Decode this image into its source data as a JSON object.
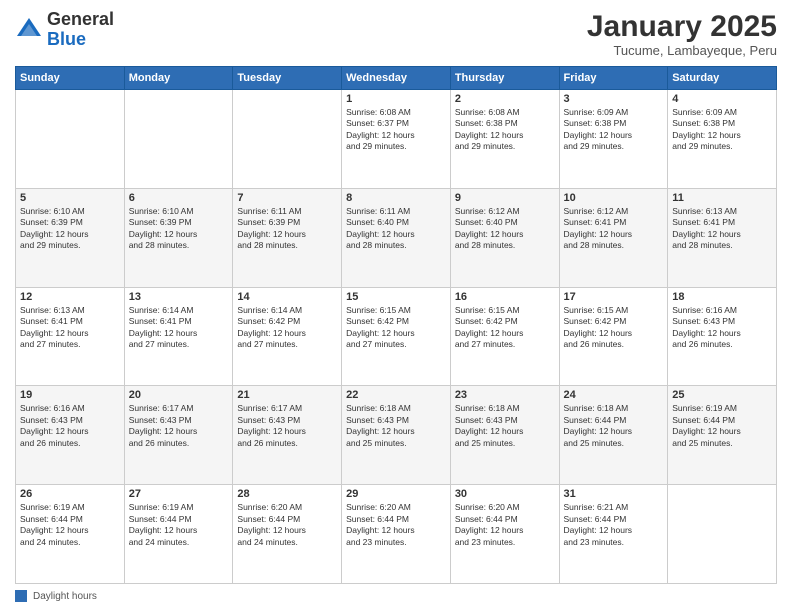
{
  "header": {
    "logo_general": "General",
    "logo_blue": "Blue",
    "month_title": "January 2025",
    "subtitle": "Tucume, Lambayeque, Peru"
  },
  "days_of_week": [
    "Sunday",
    "Monday",
    "Tuesday",
    "Wednesday",
    "Thursday",
    "Friday",
    "Saturday"
  ],
  "legend": {
    "label": "Daylight hours"
  },
  "weeks": [
    [
      {
        "day": "",
        "info": ""
      },
      {
        "day": "",
        "info": ""
      },
      {
        "day": "",
        "info": ""
      },
      {
        "day": "1",
        "info": "Sunrise: 6:08 AM\nSunset: 6:37 PM\nDaylight: 12 hours\nand 29 minutes."
      },
      {
        "day": "2",
        "info": "Sunrise: 6:08 AM\nSunset: 6:38 PM\nDaylight: 12 hours\nand 29 minutes."
      },
      {
        "day": "3",
        "info": "Sunrise: 6:09 AM\nSunset: 6:38 PM\nDaylight: 12 hours\nand 29 minutes."
      },
      {
        "day": "4",
        "info": "Sunrise: 6:09 AM\nSunset: 6:38 PM\nDaylight: 12 hours\nand 29 minutes."
      }
    ],
    [
      {
        "day": "5",
        "info": "Sunrise: 6:10 AM\nSunset: 6:39 PM\nDaylight: 12 hours\nand 29 minutes."
      },
      {
        "day": "6",
        "info": "Sunrise: 6:10 AM\nSunset: 6:39 PM\nDaylight: 12 hours\nand 28 minutes."
      },
      {
        "day": "7",
        "info": "Sunrise: 6:11 AM\nSunset: 6:39 PM\nDaylight: 12 hours\nand 28 minutes."
      },
      {
        "day": "8",
        "info": "Sunrise: 6:11 AM\nSunset: 6:40 PM\nDaylight: 12 hours\nand 28 minutes."
      },
      {
        "day": "9",
        "info": "Sunrise: 6:12 AM\nSunset: 6:40 PM\nDaylight: 12 hours\nand 28 minutes."
      },
      {
        "day": "10",
        "info": "Sunrise: 6:12 AM\nSunset: 6:41 PM\nDaylight: 12 hours\nand 28 minutes."
      },
      {
        "day": "11",
        "info": "Sunrise: 6:13 AM\nSunset: 6:41 PM\nDaylight: 12 hours\nand 28 minutes."
      }
    ],
    [
      {
        "day": "12",
        "info": "Sunrise: 6:13 AM\nSunset: 6:41 PM\nDaylight: 12 hours\nand 27 minutes."
      },
      {
        "day": "13",
        "info": "Sunrise: 6:14 AM\nSunset: 6:41 PM\nDaylight: 12 hours\nand 27 minutes."
      },
      {
        "day": "14",
        "info": "Sunrise: 6:14 AM\nSunset: 6:42 PM\nDaylight: 12 hours\nand 27 minutes."
      },
      {
        "day": "15",
        "info": "Sunrise: 6:15 AM\nSunset: 6:42 PM\nDaylight: 12 hours\nand 27 minutes."
      },
      {
        "day": "16",
        "info": "Sunrise: 6:15 AM\nSunset: 6:42 PM\nDaylight: 12 hours\nand 27 minutes."
      },
      {
        "day": "17",
        "info": "Sunrise: 6:15 AM\nSunset: 6:42 PM\nDaylight: 12 hours\nand 26 minutes."
      },
      {
        "day": "18",
        "info": "Sunrise: 6:16 AM\nSunset: 6:43 PM\nDaylight: 12 hours\nand 26 minutes."
      }
    ],
    [
      {
        "day": "19",
        "info": "Sunrise: 6:16 AM\nSunset: 6:43 PM\nDaylight: 12 hours\nand 26 minutes."
      },
      {
        "day": "20",
        "info": "Sunrise: 6:17 AM\nSunset: 6:43 PM\nDaylight: 12 hours\nand 26 minutes."
      },
      {
        "day": "21",
        "info": "Sunrise: 6:17 AM\nSunset: 6:43 PM\nDaylight: 12 hours\nand 26 minutes."
      },
      {
        "day": "22",
        "info": "Sunrise: 6:18 AM\nSunset: 6:43 PM\nDaylight: 12 hours\nand 25 minutes."
      },
      {
        "day": "23",
        "info": "Sunrise: 6:18 AM\nSunset: 6:43 PM\nDaylight: 12 hours\nand 25 minutes."
      },
      {
        "day": "24",
        "info": "Sunrise: 6:18 AM\nSunset: 6:44 PM\nDaylight: 12 hours\nand 25 minutes."
      },
      {
        "day": "25",
        "info": "Sunrise: 6:19 AM\nSunset: 6:44 PM\nDaylight: 12 hours\nand 25 minutes."
      }
    ],
    [
      {
        "day": "26",
        "info": "Sunrise: 6:19 AM\nSunset: 6:44 PM\nDaylight: 12 hours\nand 24 minutes."
      },
      {
        "day": "27",
        "info": "Sunrise: 6:19 AM\nSunset: 6:44 PM\nDaylight: 12 hours\nand 24 minutes."
      },
      {
        "day": "28",
        "info": "Sunrise: 6:20 AM\nSunset: 6:44 PM\nDaylight: 12 hours\nand 24 minutes."
      },
      {
        "day": "29",
        "info": "Sunrise: 6:20 AM\nSunset: 6:44 PM\nDaylight: 12 hours\nand 23 minutes."
      },
      {
        "day": "30",
        "info": "Sunrise: 6:20 AM\nSunset: 6:44 PM\nDaylight: 12 hours\nand 23 minutes."
      },
      {
        "day": "31",
        "info": "Sunrise: 6:21 AM\nSunset: 6:44 PM\nDaylight: 12 hours\nand 23 minutes."
      },
      {
        "day": "",
        "info": ""
      }
    ]
  ]
}
